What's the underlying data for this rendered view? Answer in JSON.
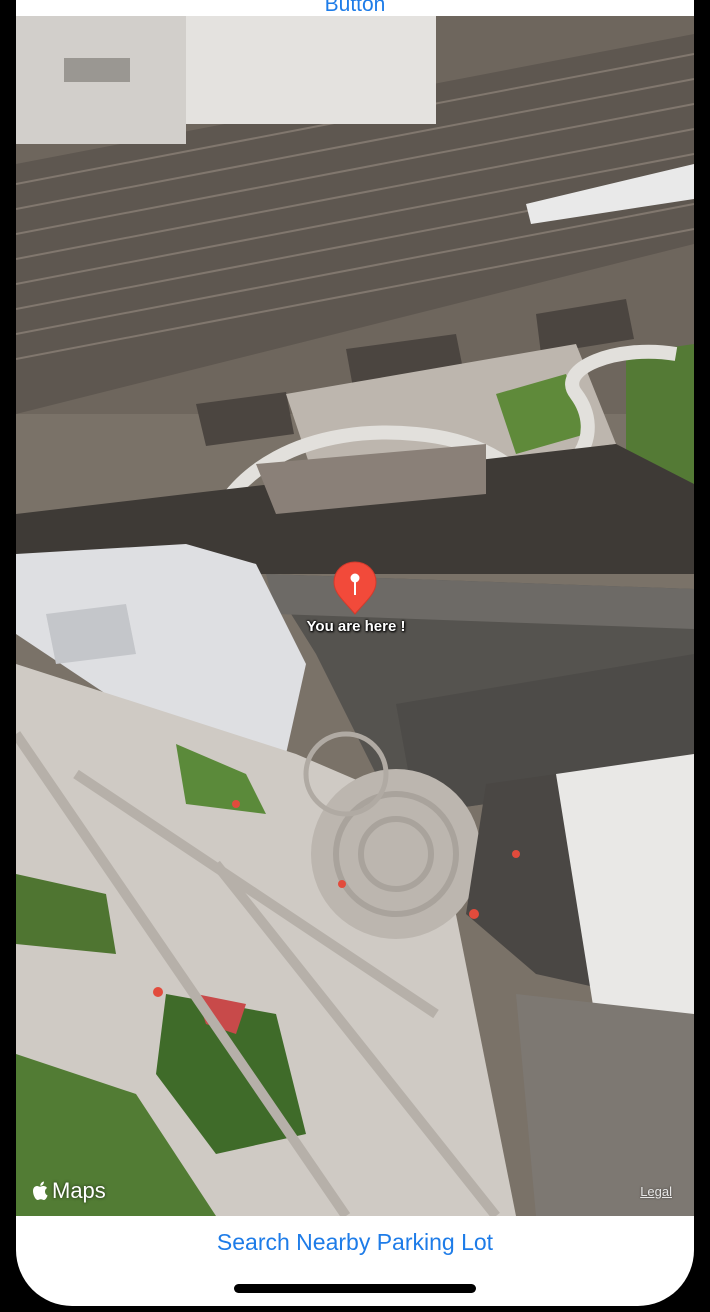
{
  "top_button": {
    "label": "Button"
  },
  "map": {
    "type": "satellite",
    "pin": {
      "label": "You are here !",
      "color": "#f24a3a"
    },
    "attribution": {
      "brand": "Maps",
      "legal": "Legal"
    }
  },
  "bottom_button": {
    "label": "Search Nearby Parking Lot"
  },
  "colors": {
    "accent": "#1e7ce8",
    "pin": "#f24a3a"
  }
}
